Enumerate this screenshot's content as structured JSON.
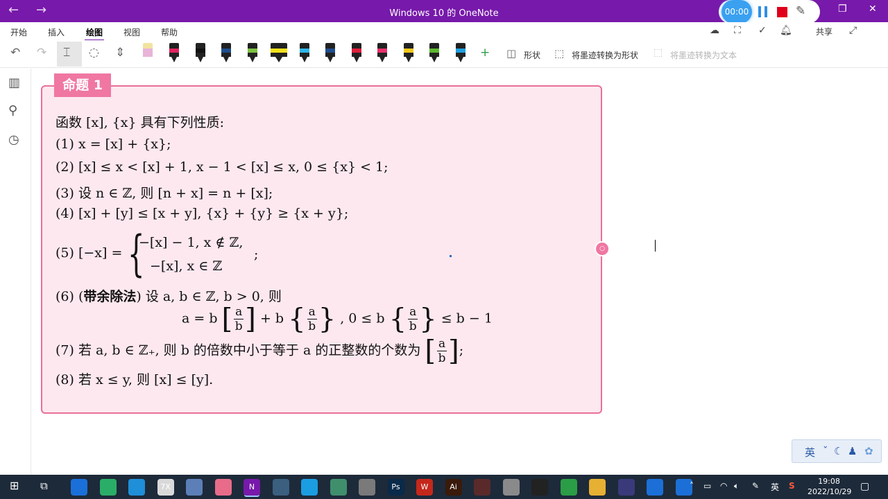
{
  "titlebar": {
    "title": "Windows 10 的 OneNote",
    "back_icon": "arrow-left-icon",
    "forward_icon": "arrow-right-icon",
    "recorder": {
      "timer": "00:00",
      "pause_icon": "pause-icon",
      "stop_icon": "stop-icon",
      "pen_icon": "pen-icon"
    },
    "restore_icon": "restore-icon",
    "close_icon": "close-icon"
  },
  "tabs": [
    {
      "label": "开始"
    },
    {
      "label": "插入"
    },
    {
      "label": "绘图",
      "active": true
    },
    {
      "label": "视图"
    },
    {
      "label": "帮助"
    }
  ],
  "share_label": "共享",
  "toolbar": {
    "shapes_label": "形状",
    "ink_to_shape_label": "将墨迹转换为形状",
    "ink_to_text_label": "将墨迹转换为文本",
    "pens": [
      {
        "color": "#e8b4d8"
      },
      {
        "color": "#e0245e"
      },
      {
        "color": "#111111"
      },
      {
        "color": "#1f4e8c"
      },
      {
        "color": "#7dc242"
      },
      {
        "color": "#f5e11b"
      },
      {
        "color": "#2fb6e6"
      },
      {
        "color": "#1f4e8c"
      },
      {
        "color": "#e01e3c"
      },
      {
        "color": "#e8316b"
      },
      {
        "color": "#f2c81b"
      },
      {
        "color": "#5cb82e"
      },
      {
        "color": "#1da0e0"
      }
    ]
  },
  "note": {
    "tag": "命题 1",
    "lines": {
      "intro": "函数 [x], {x} 具有下列性质:",
      "p1": "(1) x = [x] + {x};",
      "p2": "(2) [x] ≤ x < [x] + 1, x − 1 < [x] ≤ x, 0 ≤ {x} < 1;",
      "p3": "(3) 设 n ∈ ℤ, 则 [n + x] = n + [x];",
      "p4": "(4) [x] + [y] ≤ [x + y], {x} + {y} ≥ {x + y};",
      "p5_lhs": "(5) [−x] =",
      "p5_case1": "−[x] − 1,    x ∉ ℤ,",
      "p5_case2": "−[x],          x ∈ ℤ",
      "p5_end": ";",
      "p6_head": "(6) (",
      "p6_bold": "带余除法",
      "p6_tail": ") 设 a, b ∈ ℤ, b > 0, 则",
      "p6_eq_a": "a = b",
      "p6_eq_b": "+ b",
      "p6_eq_c": ",  0 ≤ b",
      "p6_eq_d": "≤ b − 1",
      "p7_text": "(7) 若 a, b ∈ ℤ₊, 则 b 的倍数中小于等于 a 的正整数的个数为",
      "p7_end": ";",
      "p8": "(8) 若 x ≤ y, 则 [x] ≤ [y].",
      "frac_num": "a",
      "frac_den": "b"
    }
  },
  "ime": {
    "label": "英"
  },
  "taskbar": {
    "clock_time": "19:08",
    "clock_date": "2022/10/29",
    "lang": "英",
    "apps": [
      {
        "label": "",
        "color": "#1a6fd8"
      },
      {
        "label": "",
        "color": "#2aae67"
      },
      {
        "label": "",
        "color": "#1e8fd8"
      },
      {
        "label": "7X",
        "color": "#d9d9d9"
      },
      {
        "label": "",
        "color": "#5c7fb8"
      },
      {
        "label": "",
        "color": "#e86b8a"
      },
      {
        "label": "N",
        "color": "#7719aa"
      },
      {
        "label": "",
        "color": "#3a5f7f"
      },
      {
        "label": "",
        "color": "#1b9de2"
      },
      {
        "label": "",
        "color": "#3f8f6d"
      },
      {
        "label": "",
        "color": "#7a7a7a"
      },
      {
        "label": "Ps",
        "color": "#0a2a4a"
      },
      {
        "label": "W",
        "color": "#c4281b"
      },
      {
        "label": "Ai",
        "color": "#3a1a0a"
      },
      {
        "label": "",
        "color": "#5a2a2a"
      },
      {
        "label": "",
        "color": "#8a8a8a"
      },
      {
        "label": "",
        "color": "#222222"
      },
      {
        "label": "",
        "color": "#2a9d46"
      },
      {
        "label": "",
        "color": "#e6b032"
      },
      {
        "label": "",
        "color": "#3a3a7a"
      },
      {
        "label": "",
        "color": "#1b6fd6"
      },
      {
        "label": "",
        "color": "#1b6fd6"
      }
    ]
  }
}
